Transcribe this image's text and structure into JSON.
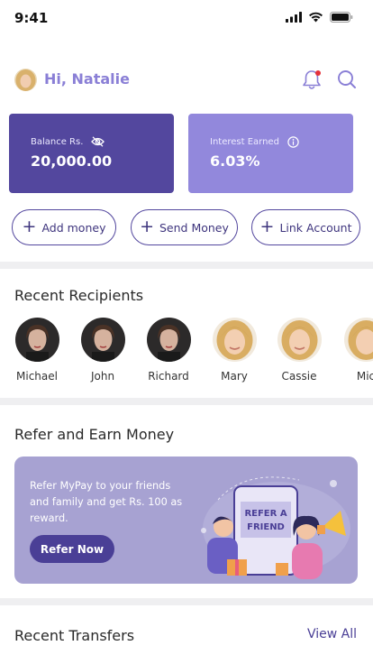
{
  "status_bar": {
    "time": "9:41"
  },
  "header": {
    "greeting": "Hi, Natalie"
  },
  "balance_card": {
    "label": "Balance Rs.",
    "value": "20,000.00"
  },
  "interest_card": {
    "label": "Interest Earned",
    "value": "6.03%"
  },
  "actions": [
    {
      "label": "Add money"
    },
    {
      "label": "Send Money"
    },
    {
      "label": "Link Account"
    }
  ],
  "recipients": {
    "title": "Recent Recipients",
    "items": [
      {
        "name": "Michael"
      },
      {
        "name": "John"
      },
      {
        "name": "Richard"
      },
      {
        "name": "Mary"
      },
      {
        "name": "Cassie"
      },
      {
        "name": "Mic"
      }
    ]
  },
  "refer": {
    "title": "Refer and Earn Money",
    "text": "Refer MyPay to your friends and family and get Rs. 100 as reward.",
    "button": "Refer Now",
    "illustration_text": "REFER A FRIEND"
  },
  "transfers": {
    "title": "Recent Transfers",
    "view_all": "View All"
  },
  "colors": {
    "primary": "#53479e",
    "accent": "#9288dc",
    "greeting": "#8a7fd6",
    "notification_dot": "#e5323b",
    "refer_bg": "#a7a2d2"
  }
}
